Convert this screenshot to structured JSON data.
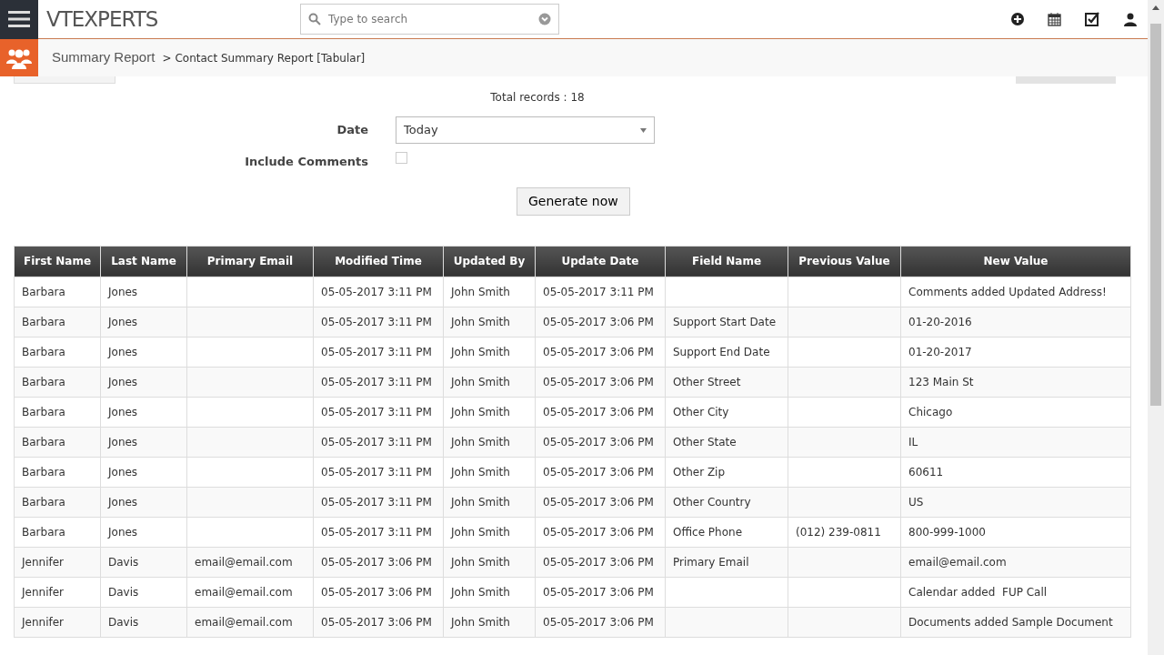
{
  "header": {
    "logo": "VTEXPERTS",
    "search": {
      "placeholder": "Type to search"
    }
  },
  "breadcrumb": {
    "module": "Summary Report",
    "separator": ">",
    "page": "Contact Summary Report [Tabular]"
  },
  "report": {
    "total": "Total records : 18",
    "filters": [
      {
        "kind": "select",
        "label": "Date",
        "value": "Today"
      },
      {
        "kind": "checkbox",
        "label": "Include Comments",
        "checked": false
      }
    ],
    "generate": "Generate now"
  },
  "table": {
    "columns": [
      "First Name",
      "Last Name",
      "Primary Email",
      "Modified Time",
      "Updated By",
      "Update Date",
      "Field Name",
      "Previous Value",
      "New Value"
    ],
    "rows": [
      [
        "Barbara",
        "Jones",
        "",
        "05-05-2017 3:11 PM",
        "John Smith",
        "05-05-2017 3:11 PM",
        "",
        "",
        "Comments added Updated Address!"
      ],
      [
        "Barbara",
        "Jones",
        "",
        "05-05-2017 3:11 PM",
        "John Smith",
        "05-05-2017 3:06 PM",
        "Support Start Date",
        "",
        "01-20-2016"
      ],
      [
        "Barbara",
        "Jones",
        "",
        "05-05-2017 3:11 PM",
        "John Smith",
        "05-05-2017 3:06 PM",
        "Support End Date",
        "",
        "01-20-2017"
      ],
      [
        "Barbara",
        "Jones",
        "",
        "05-05-2017 3:11 PM",
        "John Smith",
        "05-05-2017 3:06 PM",
        "Other Street",
        "",
        "123 Main St"
      ],
      [
        "Barbara",
        "Jones",
        "",
        "05-05-2017 3:11 PM",
        "John Smith",
        "05-05-2017 3:06 PM",
        "Other City",
        "",
        "Chicago"
      ],
      [
        "Barbara",
        "Jones",
        "",
        "05-05-2017 3:11 PM",
        "John Smith",
        "05-05-2017 3:06 PM",
        "Other State",
        "",
        "IL"
      ],
      [
        "Barbara",
        "Jones",
        "",
        "05-05-2017 3:11 PM",
        "John Smith",
        "05-05-2017 3:06 PM",
        "Other Zip",
        "",
        "60611"
      ],
      [
        "Barbara",
        "Jones",
        "",
        "05-05-2017 3:11 PM",
        "John Smith",
        "05-05-2017 3:06 PM",
        "Other Country",
        "",
        "US"
      ],
      [
        "Barbara",
        "Jones",
        "",
        "05-05-2017 3:11 PM",
        "John Smith",
        "05-05-2017 3:06 PM",
        "Office Phone",
        "(012) 239-0811",
        "800-999-1000"
      ],
      [
        "Jennifer",
        "Davis",
        "email@email.com",
        "05-05-2017 3:06 PM",
        "John Smith",
        "05-05-2017 3:06 PM",
        "Primary Email",
        "",
        "email@email.com"
      ],
      [
        "Jennifer",
        "Davis",
        "email@email.com",
        "05-05-2017 3:06 PM",
        "John Smith",
        "05-05-2017 3:06 PM",
        "",
        "",
        "Calendar added  FUP Call"
      ],
      [
        "Jennifer",
        "Davis",
        "email@email.com",
        "05-05-2017 3:06 PM",
        "John Smith",
        "05-05-2017 3:06 PM",
        "",
        "",
        "Documents added Sample Document"
      ]
    ]
  }
}
